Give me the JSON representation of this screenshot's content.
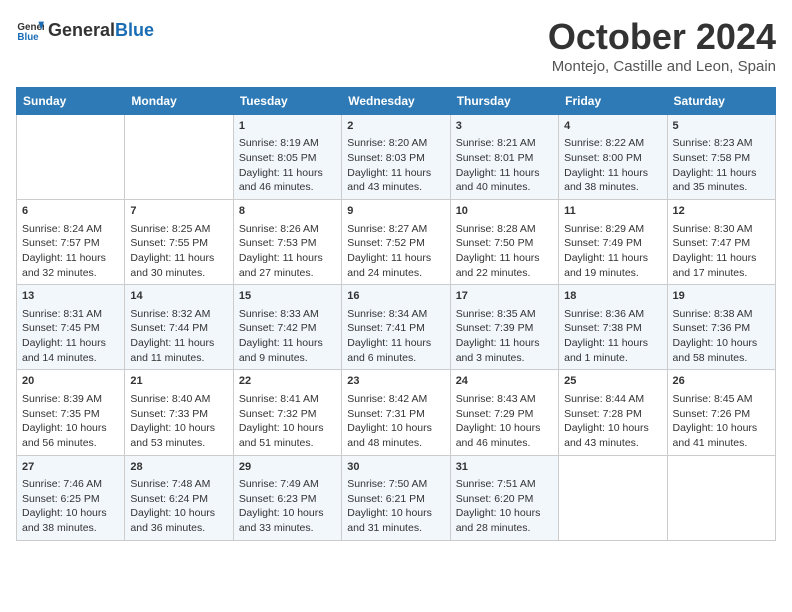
{
  "header": {
    "logo": {
      "text_general": "General",
      "text_blue": "Blue"
    },
    "title": "October 2024",
    "location": "Montejo, Castille and Leon, Spain"
  },
  "calendar": {
    "days_of_week": [
      "Sunday",
      "Monday",
      "Tuesday",
      "Wednesday",
      "Thursday",
      "Friday",
      "Saturday"
    ],
    "weeks": [
      [
        {
          "day": "",
          "info": ""
        },
        {
          "day": "",
          "info": ""
        },
        {
          "day": "1",
          "info": "Sunrise: 8:19 AM\nSunset: 8:05 PM\nDaylight: 11 hours\nand 46 minutes."
        },
        {
          "day": "2",
          "info": "Sunrise: 8:20 AM\nSunset: 8:03 PM\nDaylight: 11 hours\nand 43 minutes."
        },
        {
          "day": "3",
          "info": "Sunrise: 8:21 AM\nSunset: 8:01 PM\nDaylight: 11 hours\nand 40 minutes."
        },
        {
          "day": "4",
          "info": "Sunrise: 8:22 AM\nSunset: 8:00 PM\nDaylight: 11 hours\nand 38 minutes."
        },
        {
          "day": "5",
          "info": "Sunrise: 8:23 AM\nSunset: 7:58 PM\nDaylight: 11 hours\nand 35 minutes."
        }
      ],
      [
        {
          "day": "6",
          "info": "Sunrise: 8:24 AM\nSunset: 7:57 PM\nDaylight: 11 hours\nand 32 minutes."
        },
        {
          "day": "7",
          "info": "Sunrise: 8:25 AM\nSunset: 7:55 PM\nDaylight: 11 hours\nand 30 minutes."
        },
        {
          "day": "8",
          "info": "Sunrise: 8:26 AM\nSunset: 7:53 PM\nDaylight: 11 hours\nand 27 minutes."
        },
        {
          "day": "9",
          "info": "Sunrise: 8:27 AM\nSunset: 7:52 PM\nDaylight: 11 hours\nand 24 minutes."
        },
        {
          "day": "10",
          "info": "Sunrise: 8:28 AM\nSunset: 7:50 PM\nDaylight: 11 hours\nand 22 minutes."
        },
        {
          "day": "11",
          "info": "Sunrise: 8:29 AM\nSunset: 7:49 PM\nDaylight: 11 hours\nand 19 minutes."
        },
        {
          "day": "12",
          "info": "Sunrise: 8:30 AM\nSunset: 7:47 PM\nDaylight: 11 hours\nand 17 minutes."
        }
      ],
      [
        {
          "day": "13",
          "info": "Sunrise: 8:31 AM\nSunset: 7:45 PM\nDaylight: 11 hours\nand 14 minutes."
        },
        {
          "day": "14",
          "info": "Sunrise: 8:32 AM\nSunset: 7:44 PM\nDaylight: 11 hours\nand 11 minutes."
        },
        {
          "day": "15",
          "info": "Sunrise: 8:33 AM\nSunset: 7:42 PM\nDaylight: 11 hours\nand 9 minutes."
        },
        {
          "day": "16",
          "info": "Sunrise: 8:34 AM\nSunset: 7:41 PM\nDaylight: 11 hours\nand 6 minutes."
        },
        {
          "day": "17",
          "info": "Sunrise: 8:35 AM\nSunset: 7:39 PM\nDaylight: 11 hours\nand 3 minutes."
        },
        {
          "day": "18",
          "info": "Sunrise: 8:36 AM\nSunset: 7:38 PM\nDaylight: 11 hours\nand 1 minute."
        },
        {
          "day": "19",
          "info": "Sunrise: 8:38 AM\nSunset: 7:36 PM\nDaylight: 10 hours\nand 58 minutes."
        }
      ],
      [
        {
          "day": "20",
          "info": "Sunrise: 8:39 AM\nSunset: 7:35 PM\nDaylight: 10 hours\nand 56 minutes."
        },
        {
          "day": "21",
          "info": "Sunrise: 8:40 AM\nSunset: 7:33 PM\nDaylight: 10 hours\nand 53 minutes."
        },
        {
          "day": "22",
          "info": "Sunrise: 8:41 AM\nSunset: 7:32 PM\nDaylight: 10 hours\nand 51 minutes."
        },
        {
          "day": "23",
          "info": "Sunrise: 8:42 AM\nSunset: 7:31 PM\nDaylight: 10 hours\nand 48 minutes."
        },
        {
          "day": "24",
          "info": "Sunrise: 8:43 AM\nSunset: 7:29 PM\nDaylight: 10 hours\nand 46 minutes."
        },
        {
          "day": "25",
          "info": "Sunrise: 8:44 AM\nSunset: 7:28 PM\nDaylight: 10 hours\nand 43 minutes."
        },
        {
          "day": "26",
          "info": "Sunrise: 8:45 AM\nSunset: 7:26 PM\nDaylight: 10 hours\nand 41 minutes."
        }
      ],
      [
        {
          "day": "27",
          "info": "Sunrise: 7:46 AM\nSunset: 6:25 PM\nDaylight: 10 hours\nand 38 minutes."
        },
        {
          "day": "28",
          "info": "Sunrise: 7:48 AM\nSunset: 6:24 PM\nDaylight: 10 hours\nand 36 minutes."
        },
        {
          "day": "29",
          "info": "Sunrise: 7:49 AM\nSunset: 6:23 PM\nDaylight: 10 hours\nand 33 minutes."
        },
        {
          "day": "30",
          "info": "Sunrise: 7:50 AM\nSunset: 6:21 PM\nDaylight: 10 hours\nand 31 minutes."
        },
        {
          "day": "31",
          "info": "Sunrise: 7:51 AM\nSunset: 6:20 PM\nDaylight: 10 hours\nand 28 minutes."
        },
        {
          "day": "",
          "info": ""
        },
        {
          "day": "",
          "info": ""
        }
      ]
    ]
  }
}
